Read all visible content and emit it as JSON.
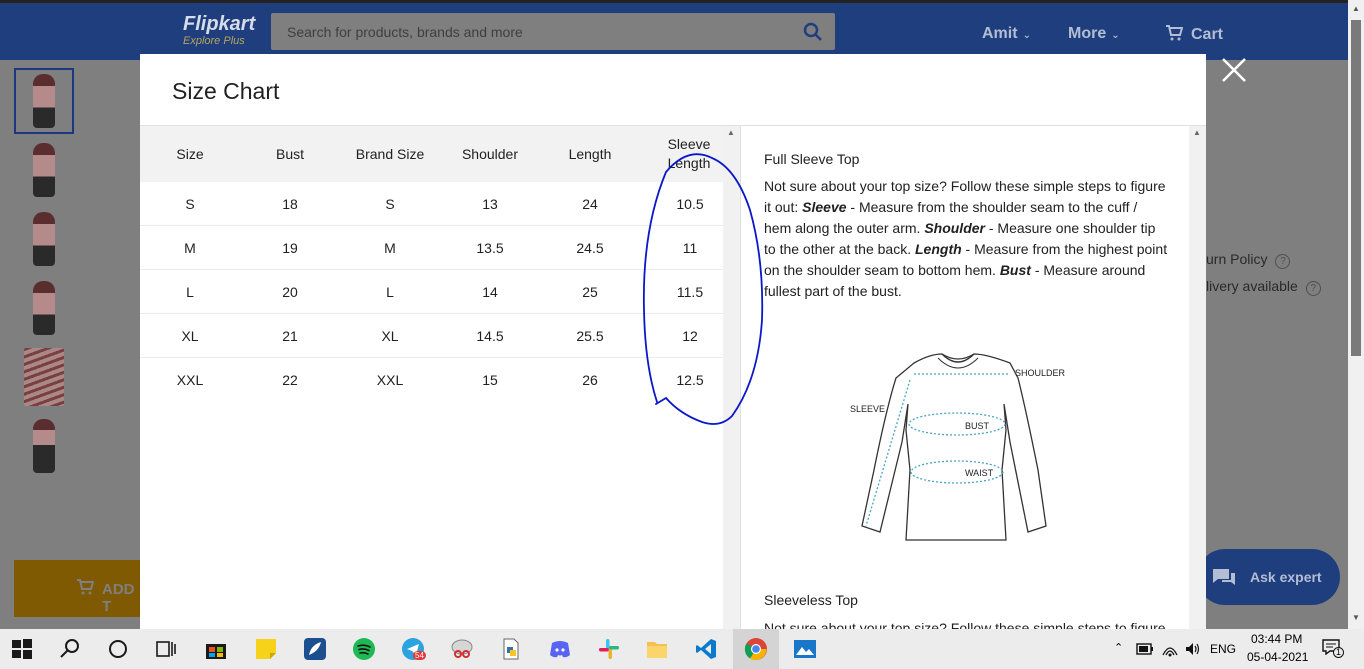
{
  "header": {
    "logo_name": "Flipkart",
    "logo_sub": "Explore Plus",
    "search_placeholder": "Search for products, brands and more",
    "nav_user": "Amit",
    "nav_more": "More",
    "nav_cart": "Cart"
  },
  "background": {
    "side_line1": "urn Policy",
    "side_line2": "livery available",
    "ask_expert": "Ask expert",
    "add_to_cart": "ADD T"
  },
  "modal": {
    "title": "Size Chart",
    "columns": [
      "Size",
      "Bust",
      "Brand Size",
      "Shoulder",
      "Length",
      "Sleeve Length"
    ],
    "rows": [
      [
        "S",
        "18",
        "S",
        "13",
        "24",
        "10.5"
      ],
      [
        "M",
        "19",
        "M",
        "13.5",
        "24.5",
        "11"
      ],
      [
        "L",
        "20",
        "L",
        "14",
        "25",
        "11.5"
      ],
      [
        "XL",
        "21",
        "XL",
        "14.5",
        "25.5",
        "12"
      ],
      [
        "XXL",
        "22",
        "XXL",
        "15",
        "26",
        "12.5"
      ]
    ],
    "info": {
      "title": "Full Sleeve Top",
      "intro": "Not sure about your top size? Follow these simple steps to figure it out: ",
      "sleeve_label": "Sleeve",
      "sleeve_text": " - Measure from the shoulder seam to the cuff / hem along the outer arm. ",
      "shoulder_label": "Shoulder",
      "shoulder_text": " - Measure one shoulder tip to the other at the back. ",
      "length_label": "Length",
      "length_text": " - Measure from the highest point on the shoulder seam to bottom hem. ",
      "bust_label": "Bust",
      "bust_text": " - Measure around fullest part of the bust.",
      "diagram_labels": {
        "shoulder": "SHOULDER",
        "sleeve": "SLEEVE",
        "bust": "BUST",
        "waist": "WAIST"
      },
      "title2": "Sleeveless Top",
      "text2": "Not sure about your top size? Follow these simple steps to figure"
    }
  },
  "taskbar": {
    "telegram_badge": "54",
    "language": "ENG",
    "time": "03:44 PM",
    "date": "05-04-2021",
    "notification_count": "1"
  },
  "colors": {
    "header": "#1f3e7e",
    "annotation": "#0a18c8",
    "overlay": "#7f7f7f"
  }
}
